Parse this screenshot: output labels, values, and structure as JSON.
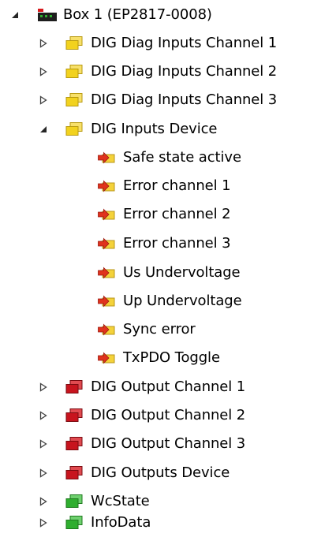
{
  "colors": {
    "folder_input": "#f2d21e",
    "folder_output": "#c8141e",
    "folder_status": "#2fae2f",
    "var_input": "#e0331d",
    "box_device": "#1d1d1d",
    "box_accent": "#d7191c"
  },
  "tree": {
    "box": {
      "label": "Box 1 (EP2817-0008)",
      "icon": "ethercat-box-icon",
      "state": "expanded"
    },
    "groups": [
      {
        "label": "DIG Diag Inputs Channel 1",
        "icon": "input-folder-icon",
        "state": "collapsed"
      },
      {
        "label": "DIG Diag Inputs Channel 2",
        "icon": "input-folder-icon",
        "state": "collapsed"
      },
      {
        "label": "DIG Diag Inputs Channel 3",
        "icon": "input-folder-icon",
        "state": "collapsed"
      },
      {
        "label": "DIG Inputs Device",
        "icon": "input-folder-icon",
        "state": "expanded"
      },
      {
        "label": "DIG Output Channel 1",
        "icon": "output-folder-icon",
        "state": "collapsed"
      },
      {
        "label": "DIG Output Channel 2",
        "icon": "output-folder-icon",
        "state": "collapsed"
      },
      {
        "label": "DIG Output Channel 3",
        "icon": "output-folder-icon",
        "state": "collapsed"
      },
      {
        "label": "DIG Outputs Device",
        "icon": "output-folder-icon",
        "state": "collapsed"
      },
      {
        "label": "WcState",
        "icon": "status-folder-icon",
        "state": "collapsed"
      },
      {
        "label": "InfoData",
        "icon": "status-folder-icon",
        "state": "collapsed"
      }
    ],
    "device_inputs": [
      {
        "label": "Safe state active",
        "icon": "input-variable-icon"
      },
      {
        "label": "Error channel 1",
        "icon": "input-variable-icon"
      },
      {
        "label": "Error channel 2",
        "icon": "input-variable-icon"
      },
      {
        "label": "Error channel 3",
        "icon": "input-variable-icon"
      },
      {
        "label": "Us Undervoltage",
        "icon": "input-variable-icon"
      },
      {
        "label": "Up Undervoltage",
        "icon": "input-variable-icon"
      },
      {
        "label": "Sync error",
        "icon": "input-variable-icon"
      },
      {
        "label": "TxPDO Toggle",
        "icon": "input-variable-icon"
      }
    ]
  }
}
